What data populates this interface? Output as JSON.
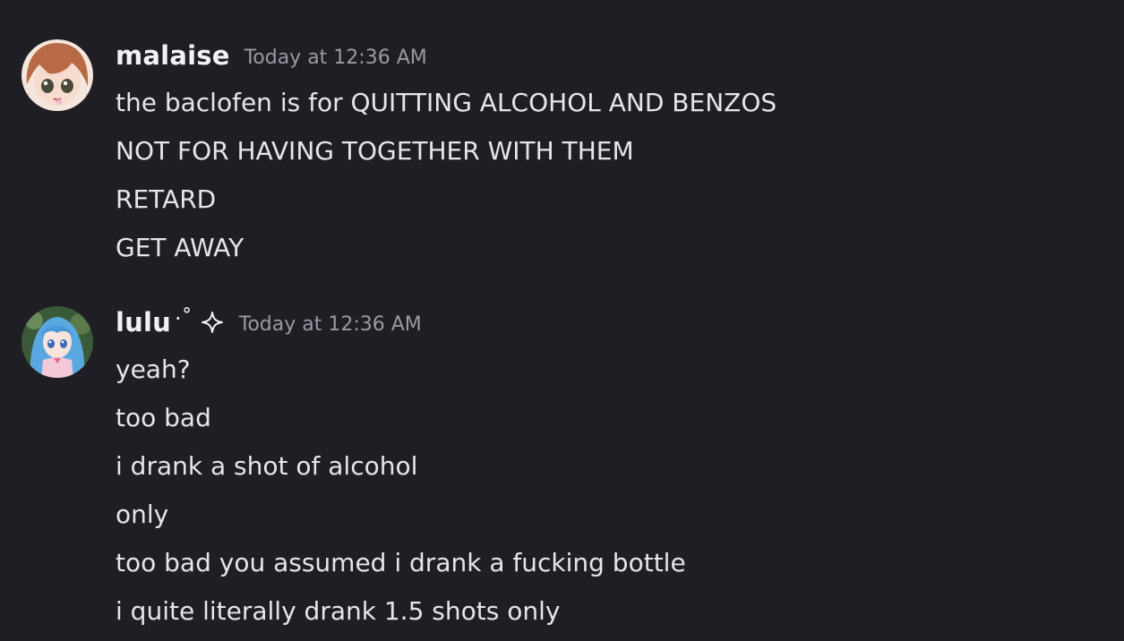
{
  "messages": [
    {
      "author": "malaise",
      "author_decoration": "",
      "timestamp": "Today at 12:36 AM",
      "avatar_icon": "anime-avatar-brown-hair",
      "lines": [
        "the baclofen is for QUITTING ALCOHOL AND BENZOS",
        "NOT FOR HAVING TOGETHER WITH THEM",
        "RETARD",
        "GET AWAY"
      ]
    },
    {
      "author": "lulu",
      "author_decoration": "·˚",
      "timestamp": "Today at 12:36 AM",
      "avatar_icon": "anime-avatar-blue-hair",
      "badge_icon": "sparkle-icon",
      "lines": [
        "yeah?",
        "too bad",
        "i drank a shot of alcohol",
        "only",
        "too bad you assumed i drank a fucking bottle",
        "i quite literally drank 1.5 shots only"
      ]
    }
  ],
  "colors": {
    "background": "#1e1e24",
    "text": "#e6e6ea",
    "timestamp": "#9a9aa3"
  }
}
